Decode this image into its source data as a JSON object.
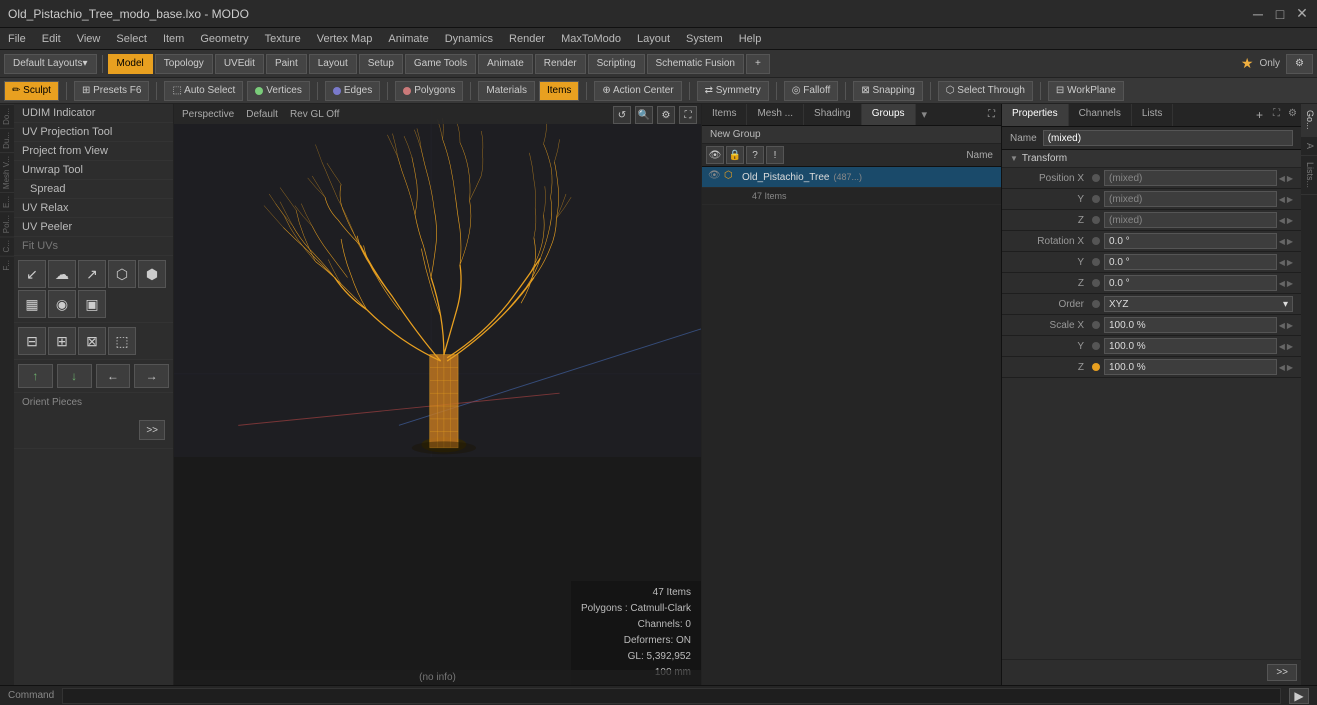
{
  "window": {
    "title": "Old_Pistachio_Tree_modo_base.lxo - MODO"
  },
  "menubar": {
    "items": [
      "File",
      "Edit",
      "View",
      "Select",
      "Item",
      "Geometry",
      "Texture",
      "Vertex Map",
      "Animate",
      "Dynamics",
      "Render",
      "MaxToModo",
      "Layout",
      "System",
      "Help"
    ]
  },
  "toolbar": {
    "layout_label": "Default Layouts",
    "settings_icon": "⚙",
    "plus_icon": "+"
  },
  "main_tabs": {
    "tabs": [
      "Model",
      "Topology",
      "UVEdit",
      "Paint",
      "Layout",
      "Setup",
      "Game Tools",
      "Animate",
      "Render",
      "Scripting",
      "Schematic Fusion"
    ],
    "active": "Model"
  },
  "tool_tabs": {
    "active": "Sculpt",
    "presets": "Presets",
    "presets_key": "F6"
  },
  "toolbar2": {
    "buttons": [
      "Auto Select",
      "Vertices",
      "Edges",
      "Polygons",
      "Materials",
      "Items",
      "Action Center",
      "Symmetry",
      "Falloff",
      "Snapping",
      "Select Through",
      "WorkPlane"
    ]
  },
  "left_tools": {
    "items": [
      "UDIM Indicator",
      "UV Projection Tool",
      "Project from View",
      "Unwrap Tool",
      "Spread",
      "UV Relax",
      "UV Peeler",
      "Fit UVs"
    ],
    "icon_rows": [
      "↙",
      "☁",
      "↗",
      "⬡",
      "⬢",
      "▦",
      "◉",
      "▣"
    ],
    "arrows": [
      "↑",
      "↓",
      "←",
      "→"
    ],
    "orient_label": "Orient Pieces",
    "expand_btn": ">>"
  },
  "viewport": {
    "perspective": "Perspective",
    "material": "Default",
    "render_mode": "Rev GL Off",
    "status_items": "47 Items",
    "status_polygons": "Polygons : Catmull-Clark",
    "status_channels": "Channels: 0",
    "status_deformers": "Deformers: ON",
    "status_gl": "GL: 5,392,952",
    "status_size": "100 mm",
    "bottom_label": "(no info)"
  },
  "right_panel": {
    "tabs": [
      "Items",
      "Mesh ...",
      "Shading",
      "Groups"
    ],
    "active_tab": "Groups",
    "new_group_label": "New Group",
    "toolbar_icons": [
      "👁",
      "🔒",
      "?",
      "!"
    ],
    "name_label": "Name",
    "tree_items": [
      {
        "name": "Old_Pistachio_Tree",
        "count": "(487...)",
        "selected": true,
        "sub": "47 Items"
      }
    ]
  },
  "properties_panel": {
    "tabs": [
      "Properties",
      "Channels",
      "Lists"
    ],
    "add_btn": "+",
    "name_label": "Name",
    "name_value": "(mixed)",
    "transform_label": "Transform",
    "fields": {
      "position_x_label": "Position X",
      "position_x": "(mixed)",
      "position_y_label": "Y",
      "position_y": "(mixed)",
      "position_z_label": "Z",
      "position_z": "(mixed)",
      "rotation_x_label": "Rotation X",
      "rotation_x": "0.0 °",
      "rotation_y_label": "Y",
      "rotation_y": "0.0 °",
      "rotation_z_label": "Z",
      "rotation_z": "0.0 °",
      "order_label": "Order",
      "order_value": "XYZ",
      "scale_x_label": "Scale X",
      "scale_x": "100.0 %",
      "scale_y_label": "Y",
      "scale_y": "100.0 %",
      "scale_z_label": "Z",
      "scale_z": "100.0 %"
    }
  },
  "right_side_tabs": [
    "Go...",
    "A",
    "Lists..."
  ],
  "statusbar": {
    "command_label": "Command",
    "run_icon": "▶"
  },
  "window_controls": {
    "minimize": "─",
    "maximize": "□",
    "close": "✕"
  }
}
